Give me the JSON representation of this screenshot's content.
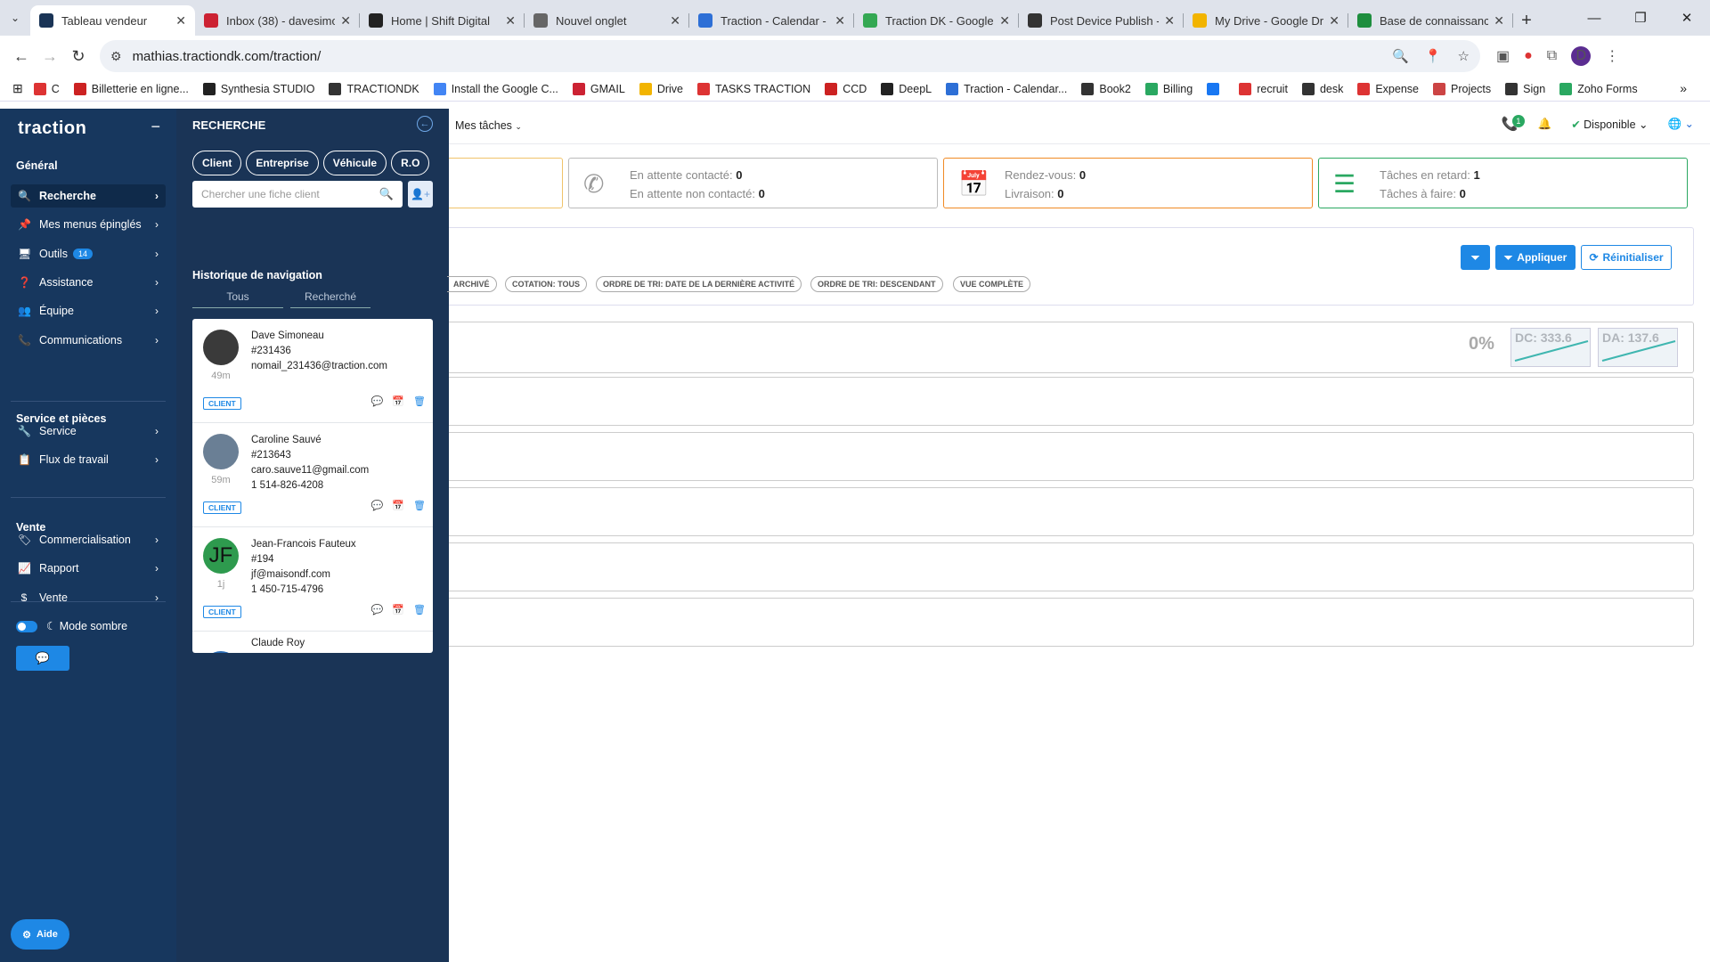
{
  "browser": {
    "tabs": [
      {
        "title": "Tableau vendeur",
        "active": true,
        "icon": "traction-favicon",
        "color": "#1a3456"
      },
      {
        "title": "Inbox (38) - davesimo",
        "active": false,
        "icon": "gmail-favicon",
        "color": "#c23"
      },
      {
        "title": "Home | Shift Digital",
        "active": false,
        "icon": "shift-favicon",
        "color": "#222"
      },
      {
        "title": "Nouvel onglet",
        "active": false,
        "icon": "chrome-favicon",
        "color": "#666"
      },
      {
        "title": "Traction - Calendar -",
        "active": false,
        "icon": "calendar-favicon",
        "color": "#2d6fd6"
      },
      {
        "title": "Traction DK - Google",
        "active": false,
        "icon": "maps-favicon",
        "color": "#34a853"
      },
      {
        "title": "Post Device Publish -",
        "active": false,
        "icon": "gear-favicon",
        "color": "#333"
      },
      {
        "title": "My Drive - Google Dr",
        "active": false,
        "icon": "drive-favicon",
        "color": "#f2b400"
      },
      {
        "title": "Base de connaissance",
        "active": false,
        "icon": "sheets-favicon",
        "color": "#1e8e3e"
      }
    ],
    "url": "mathias.tractiondk.com/traction/",
    "profile_initial": "D",
    "bookmarks": [
      "C",
      "Billetterie en ligne...",
      "Synthesia STUDIO",
      "TRACTIONDK",
      "Install the Google C...",
      "GMAIL",
      "Drive",
      "TASKS TRACTION",
      "CCD",
      "DeepL",
      "Traction - Calendar...",
      "Book2",
      "Billing",
      "",
      "recruit",
      "desk",
      "Expense",
      "Projects",
      "Sign",
      "Zoho Forms"
    ]
  },
  "sidebar": {
    "logo": "traction",
    "general_heading": "Général",
    "general_items": [
      {
        "label": "Recherche",
        "icon": "search-icon",
        "glyph": "🔍",
        "active": true
      },
      {
        "label": "Mes menus épinglés",
        "icon": "pin-icon",
        "glyph": "📌"
      },
      {
        "label": "Outils",
        "icon": "monitor-icon",
        "glyph": "🖥",
        "badge": "14"
      },
      {
        "label": "Assistance",
        "icon": "question-icon",
        "glyph": "❓"
      },
      {
        "label": "Équipe",
        "icon": "team-icon",
        "glyph": "👥"
      },
      {
        "label": "Communications",
        "icon": "phone-icon",
        "glyph": "📞"
      }
    ],
    "service_heading": "Service et pièces",
    "service_items": [
      {
        "label": "Service",
        "icon": "wrench-icon",
        "glyph": "🔧"
      },
      {
        "label": "Flux de travail",
        "icon": "clipboard-icon",
        "glyph": "📋"
      }
    ],
    "sales_heading": "Vente",
    "sales_items": [
      {
        "label": "Commercialisation",
        "icon": "tag-icon",
        "glyph": "🏷"
      },
      {
        "label": "Rapport",
        "icon": "chart-icon",
        "glyph": "📈"
      },
      {
        "label": "Vente",
        "icon": "dollar-icon",
        "glyph": "$"
      }
    ],
    "dark_mode_label": "Mode sombre",
    "help_label": "Aide"
  },
  "search_panel": {
    "title": "RECHERCHE",
    "chips": [
      "Client",
      "Entreprise",
      "Véhicule",
      "R.O"
    ],
    "search_placeholder": "Chercher une fiche client",
    "history_title": "Historique de navigation",
    "history_tabs": [
      "Tous",
      "Recherché"
    ],
    "cards": [
      {
        "name": "Dave Simoneau",
        "id": "#231436",
        "email": "nomail_231436@traction.com",
        "phone": "",
        "ago": "49m",
        "tag": "CLIENT",
        "avatar_color": "#3a3a3a",
        "initials": ""
      },
      {
        "name": "Caroline Sauvé",
        "id": "#213643",
        "email": "caro.sauve11@gmail.com",
        "phone": "1 514-826-4208",
        "ago": "59m",
        "tag": "CLIENT",
        "avatar_color": "#6a7f95",
        "initials": ""
      },
      {
        "name": "Jean-Francois Fauteux",
        "id": "#194",
        "email": "jf@maisondf.com",
        "phone": "1 450-715-4796",
        "ago": "1j",
        "tag": "CLIENT",
        "avatar_color": "#2e9a4e",
        "initials": "JF"
      },
      {
        "name": "Claude Roy",
        "id": "",
        "email": "",
        "phone": "",
        "ago": "",
        "tag": "",
        "avatar_color": "#2a6cb5",
        "initials": "CR"
      }
    ]
  },
  "topbar": {
    "my_tasks": "Mes tâches",
    "calls_badge": "1",
    "status": "Disponible"
  },
  "stats": [
    {
      "icon": "phone-slash-icon",
      "color": "#999",
      "line1_label": "En attente contacté:",
      "line1_value": "0",
      "line2_label": "En attente non contacté:",
      "line2_value": "0",
      "border": "#bbb"
    },
    {
      "icon": "calendar-clock-icon",
      "color": "#f08a24",
      "line1_label": "Rendez-vous:",
      "line1_value": "0",
      "line2_label": "Livraison:",
      "line2_value": "0",
      "border": "#f08a24"
    },
    {
      "icon": "tasks-icon",
      "color": "#2aa861",
      "line1_label": "Tâches en retard:",
      "line1_value": "1",
      "line2_label": "Tâches à faire:",
      "line2_value": "0",
      "border": "#2aa861"
    }
  ],
  "filters": {
    "chips": [
      "ARCHIVÉ",
      "COTATION: TOUS",
      "ORDRE DE TRI: DATE DE LA DERNIÈRE ACTIVITÉ",
      "ORDRE DE TRI: DESCENDANT",
      "VUE COMPLÈTE"
    ],
    "apply_label": "Appliquer",
    "reset_label": "Réinitialiser"
  },
  "summary": {
    "percent": "0%",
    "dc_label": "DC: 333.6",
    "da_label": "DA: 137.6"
  }
}
